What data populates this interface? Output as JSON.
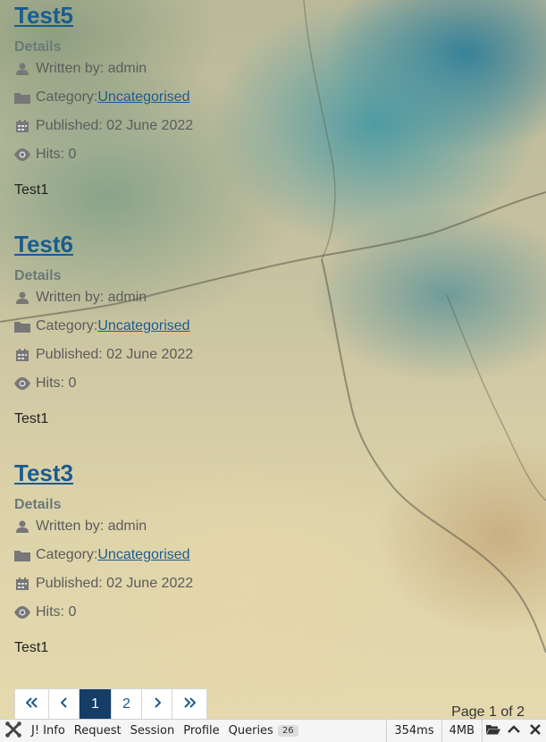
{
  "articles": [
    {
      "title": "Test5",
      "details_label": "Details",
      "written_by": "Written by: admin",
      "category_prefix": "Category: ",
      "category": "Uncategorised",
      "published": "Published: 02 June 2022",
      "hits": "Hits: 0",
      "body": "Test1"
    },
    {
      "title": "Test6",
      "details_label": "Details",
      "written_by": "Written by: admin",
      "category_prefix": "Category: ",
      "category": "Uncategorised",
      "published": "Published: 02 June 2022",
      "hits": "Hits: 0",
      "body": "Test1"
    },
    {
      "title": "Test3",
      "details_label": "Details",
      "written_by": "Written by: admin",
      "category_prefix": "Category: ",
      "category": "Uncategorised",
      "published": "Published: 02 June 2022",
      "hits": "Hits: 0",
      "body": "Test1"
    }
  ],
  "pagination": {
    "pages": [
      "1",
      "2"
    ],
    "active_page": "1",
    "counter": "Page 1 of 2",
    "icons": [
      "double-chevron-left-icon",
      "chevron-left-icon",
      "chevron-right-icon",
      "double-chevron-right-icon"
    ]
  },
  "debugbar": {
    "tabs": [
      "J! Info",
      "Request",
      "Session",
      "Profile",
      "Queries"
    ],
    "queries_count": "26",
    "time": "354ms",
    "memory": "4MB",
    "icons": [
      "joomla-logo-icon",
      "folder-open-icon",
      "chevron-up-icon",
      "close-icon"
    ]
  },
  "colors": {
    "link": "#1b5c8e",
    "active_page": "#153d66"
  }
}
